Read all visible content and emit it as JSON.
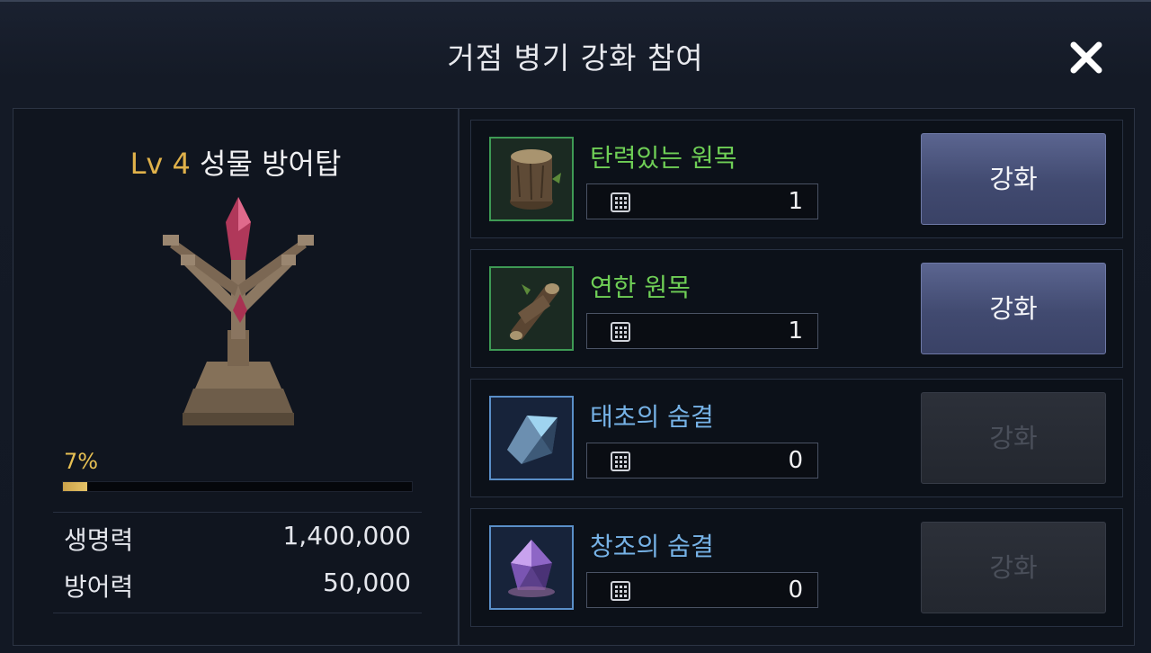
{
  "dialog": {
    "title": "거점 병기 강화 참여"
  },
  "tower": {
    "level_label": "Lv 4",
    "name": "성물 방어탑",
    "progress_text": "7%",
    "progress_fraction": 0.07,
    "stats": [
      {
        "label": "생명력",
        "value": "1,400,000"
      },
      {
        "label": "방어력",
        "value": "50,000"
      }
    ]
  },
  "materials": [
    {
      "name": "탄력있는 원목",
      "quantity": "1",
      "button": "강화",
      "enabled": true,
      "grade_color": "#6fcf56",
      "icon": "stump-icon"
    },
    {
      "name": "연한 원목",
      "quantity": "1",
      "button": "강화",
      "enabled": true,
      "grade_color": "#6fcf56",
      "icon": "log-icon"
    },
    {
      "name": "태초의 숨결",
      "quantity": "0",
      "button": "강화",
      "enabled": false,
      "grade_color": "#76b2e6",
      "icon": "crystal-shard-icon"
    },
    {
      "name": "창조의 숨결",
      "quantity": "0",
      "button": "강화",
      "enabled": false,
      "grade_color": "#76b2e6",
      "icon": "gem-icon"
    }
  ],
  "colors": {
    "level_accent": "#e0b14a",
    "progress_accent": "#e7c053",
    "button_active": "#414a70"
  }
}
